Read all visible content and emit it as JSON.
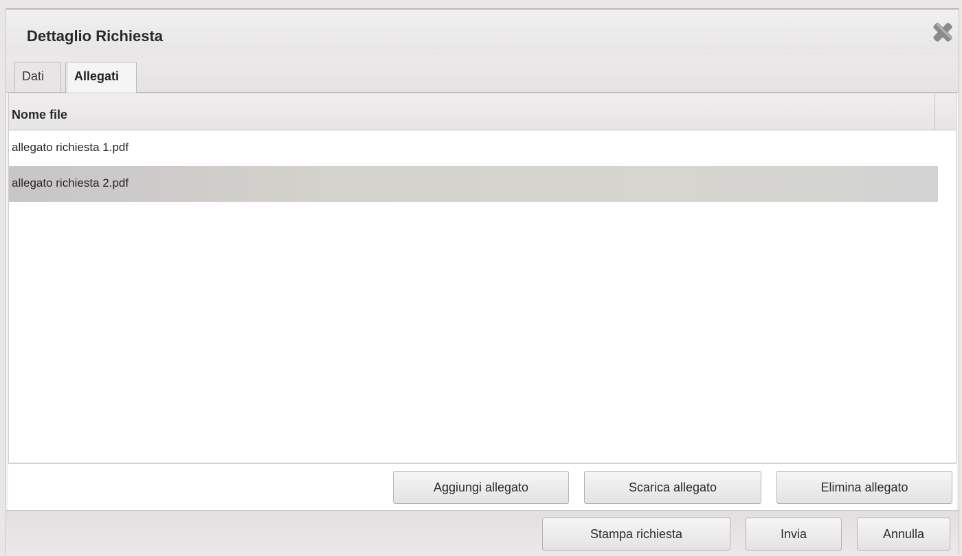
{
  "dialog": {
    "title": "Dettaglio Richiesta"
  },
  "tabs": [
    {
      "label": "Dati",
      "active": false
    },
    {
      "label": "Allegati",
      "active": true
    }
  ],
  "grid": {
    "columns": [
      "Nome file"
    ],
    "rows": [
      {
        "name": "allegato richiesta 1.pdf",
        "selected": false
      },
      {
        "name": "allegato richiesta 2.pdf",
        "selected": true
      }
    ]
  },
  "attachment_buttons": {
    "add": "Aggiungi allegato",
    "download": "Scarica allegato",
    "delete": "Elimina allegato"
  },
  "footer_buttons": {
    "print": "Stampa richiesta",
    "send": "Invia",
    "cancel": "Annulla"
  },
  "icons": {
    "close": "close-icon"
  },
  "colors": {
    "selected_row": "#d2d0cc",
    "header_bg": "#ebe9e9",
    "close_icon": "#8b8a8c"
  }
}
